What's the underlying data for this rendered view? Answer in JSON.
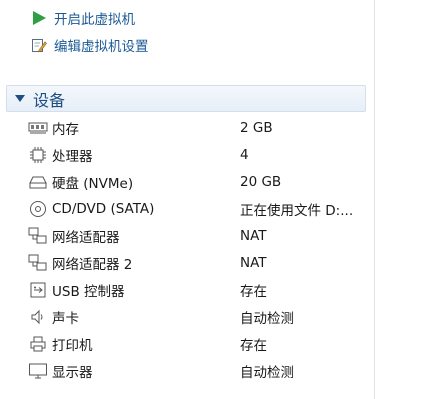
{
  "actions": [
    {
      "label": "开启此虚拟机",
      "icon": "play-icon"
    },
    {
      "label": "编辑虚拟机设置",
      "icon": "edit-settings-icon"
    }
  ],
  "section": {
    "title": "设备",
    "icon": "collapse-arrow-icon"
  },
  "devices": [
    {
      "name": "内存",
      "value": "2 GB",
      "icon": "memory-icon"
    },
    {
      "name": "处理器",
      "value": "4",
      "icon": "processor-icon"
    },
    {
      "name": "硬盘 (NVMe)",
      "value": "20 GB",
      "icon": "hard-disk-icon"
    },
    {
      "name": "CD/DVD (SATA)",
      "value": "正在使用文件 D:...",
      "icon": "cd-dvd-icon"
    },
    {
      "name": "网络适配器",
      "value": "NAT",
      "icon": "network-adapter-icon"
    },
    {
      "name": "网络适配器 2",
      "value": "NAT",
      "icon": "network-adapter-icon"
    },
    {
      "name": "USB 控制器",
      "value": "存在",
      "icon": "usb-icon"
    },
    {
      "name": "声卡",
      "value": "自动检测",
      "icon": "sound-card-icon"
    },
    {
      "name": "打印机",
      "value": "存在",
      "icon": "printer-icon"
    },
    {
      "name": "显示器",
      "value": "自动检测",
      "icon": "display-icon"
    }
  ]
}
